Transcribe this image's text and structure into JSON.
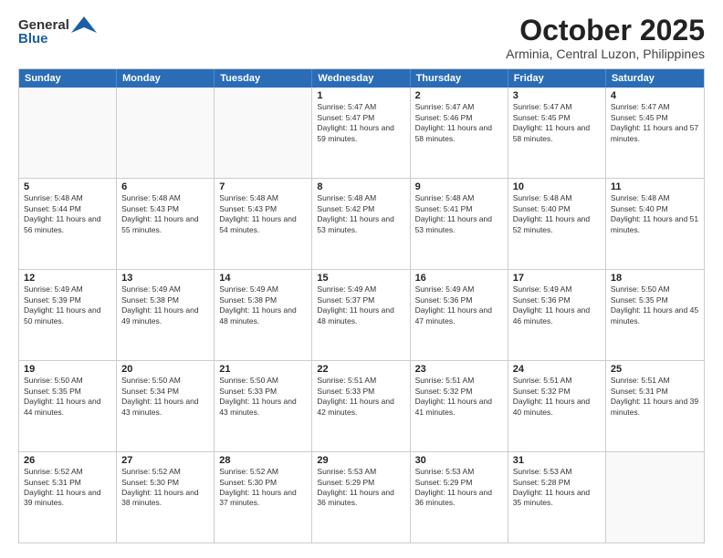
{
  "logo": {
    "line1": "General",
    "line2": "Blue"
  },
  "title": "October 2025",
  "location": "Arminia, Central Luzon, Philippines",
  "days": [
    "Sunday",
    "Monday",
    "Tuesday",
    "Wednesday",
    "Thursday",
    "Friday",
    "Saturday"
  ],
  "weeks": [
    [
      {
        "day": "",
        "sunrise": "",
        "sunset": "",
        "daylight": "",
        "empty": true
      },
      {
        "day": "",
        "sunrise": "",
        "sunset": "",
        "daylight": "",
        "empty": true
      },
      {
        "day": "",
        "sunrise": "",
        "sunset": "",
        "daylight": "",
        "empty": true
      },
      {
        "day": "1",
        "sunrise": "Sunrise: 5:47 AM",
        "sunset": "Sunset: 5:47 PM",
        "daylight": "Daylight: 11 hours and 59 minutes."
      },
      {
        "day": "2",
        "sunrise": "Sunrise: 5:47 AM",
        "sunset": "Sunset: 5:46 PM",
        "daylight": "Daylight: 11 hours and 58 minutes."
      },
      {
        "day": "3",
        "sunrise": "Sunrise: 5:47 AM",
        "sunset": "Sunset: 5:45 PM",
        "daylight": "Daylight: 11 hours and 58 minutes."
      },
      {
        "day": "4",
        "sunrise": "Sunrise: 5:47 AM",
        "sunset": "Sunset: 5:45 PM",
        "daylight": "Daylight: 11 hours and 57 minutes."
      }
    ],
    [
      {
        "day": "5",
        "sunrise": "Sunrise: 5:48 AM",
        "sunset": "Sunset: 5:44 PM",
        "daylight": "Daylight: 11 hours and 56 minutes."
      },
      {
        "day": "6",
        "sunrise": "Sunrise: 5:48 AM",
        "sunset": "Sunset: 5:43 PM",
        "daylight": "Daylight: 11 hours and 55 minutes."
      },
      {
        "day": "7",
        "sunrise": "Sunrise: 5:48 AM",
        "sunset": "Sunset: 5:43 PM",
        "daylight": "Daylight: 11 hours and 54 minutes."
      },
      {
        "day": "8",
        "sunrise": "Sunrise: 5:48 AM",
        "sunset": "Sunset: 5:42 PM",
        "daylight": "Daylight: 11 hours and 53 minutes."
      },
      {
        "day": "9",
        "sunrise": "Sunrise: 5:48 AM",
        "sunset": "Sunset: 5:41 PM",
        "daylight": "Daylight: 11 hours and 53 minutes."
      },
      {
        "day": "10",
        "sunrise": "Sunrise: 5:48 AM",
        "sunset": "Sunset: 5:40 PM",
        "daylight": "Daylight: 11 hours and 52 minutes."
      },
      {
        "day": "11",
        "sunrise": "Sunrise: 5:48 AM",
        "sunset": "Sunset: 5:40 PM",
        "daylight": "Daylight: 11 hours and 51 minutes."
      }
    ],
    [
      {
        "day": "12",
        "sunrise": "Sunrise: 5:49 AM",
        "sunset": "Sunset: 5:39 PM",
        "daylight": "Daylight: 11 hours and 50 minutes."
      },
      {
        "day": "13",
        "sunrise": "Sunrise: 5:49 AM",
        "sunset": "Sunset: 5:38 PM",
        "daylight": "Daylight: 11 hours and 49 minutes."
      },
      {
        "day": "14",
        "sunrise": "Sunrise: 5:49 AM",
        "sunset": "Sunset: 5:38 PM",
        "daylight": "Daylight: 11 hours and 48 minutes."
      },
      {
        "day": "15",
        "sunrise": "Sunrise: 5:49 AM",
        "sunset": "Sunset: 5:37 PM",
        "daylight": "Daylight: 11 hours and 48 minutes."
      },
      {
        "day": "16",
        "sunrise": "Sunrise: 5:49 AM",
        "sunset": "Sunset: 5:36 PM",
        "daylight": "Daylight: 11 hours and 47 minutes."
      },
      {
        "day": "17",
        "sunrise": "Sunrise: 5:49 AM",
        "sunset": "Sunset: 5:36 PM",
        "daylight": "Daylight: 11 hours and 46 minutes."
      },
      {
        "day": "18",
        "sunrise": "Sunrise: 5:50 AM",
        "sunset": "Sunset: 5:35 PM",
        "daylight": "Daylight: 11 hours and 45 minutes."
      }
    ],
    [
      {
        "day": "19",
        "sunrise": "Sunrise: 5:50 AM",
        "sunset": "Sunset: 5:35 PM",
        "daylight": "Daylight: 11 hours and 44 minutes."
      },
      {
        "day": "20",
        "sunrise": "Sunrise: 5:50 AM",
        "sunset": "Sunset: 5:34 PM",
        "daylight": "Daylight: 11 hours and 43 minutes."
      },
      {
        "day": "21",
        "sunrise": "Sunrise: 5:50 AM",
        "sunset": "Sunset: 5:33 PM",
        "daylight": "Daylight: 11 hours and 43 minutes."
      },
      {
        "day": "22",
        "sunrise": "Sunrise: 5:51 AM",
        "sunset": "Sunset: 5:33 PM",
        "daylight": "Daylight: 11 hours and 42 minutes."
      },
      {
        "day": "23",
        "sunrise": "Sunrise: 5:51 AM",
        "sunset": "Sunset: 5:32 PM",
        "daylight": "Daylight: 11 hours and 41 minutes."
      },
      {
        "day": "24",
        "sunrise": "Sunrise: 5:51 AM",
        "sunset": "Sunset: 5:32 PM",
        "daylight": "Daylight: 11 hours and 40 minutes."
      },
      {
        "day": "25",
        "sunrise": "Sunrise: 5:51 AM",
        "sunset": "Sunset: 5:31 PM",
        "daylight": "Daylight: 11 hours and 39 minutes."
      }
    ],
    [
      {
        "day": "26",
        "sunrise": "Sunrise: 5:52 AM",
        "sunset": "Sunset: 5:31 PM",
        "daylight": "Daylight: 11 hours and 39 minutes."
      },
      {
        "day": "27",
        "sunrise": "Sunrise: 5:52 AM",
        "sunset": "Sunset: 5:30 PM",
        "daylight": "Daylight: 11 hours and 38 minutes."
      },
      {
        "day": "28",
        "sunrise": "Sunrise: 5:52 AM",
        "sunset": "Sunset: 5:30 PM",
        "daylight": "Daylight: 11 hours and 37 minutes."
      },
      {
        "day": "29",
        "sunrise": "Sunrise: 5:53 AM",
        "sunset": "Sunset: 5:29 PM",
        "daylight": "Daylight: 11 hours and 36 minutes."
      },
      {
        "day": "30",
        "sunrise": "Sunrise: 5:53 AM",
        "sunset": "Sunset: 5:29 PM",
        "daylight": "Daylight: 11 hours and 36 minutes."
      },
      {
        "day": "31",
        "sunrise": "Sunrise: 5:53 AM",
        "sunset": "Sunset: 5:28 PM",
        "daylight": "Daylight: 11 hours and 35 minutes."
      },
      {
        "day": "",
        "sunrise": "",
        "sunset": "",
        "daylight": "",
        "empty": true
      }
    ]
  ]
}
